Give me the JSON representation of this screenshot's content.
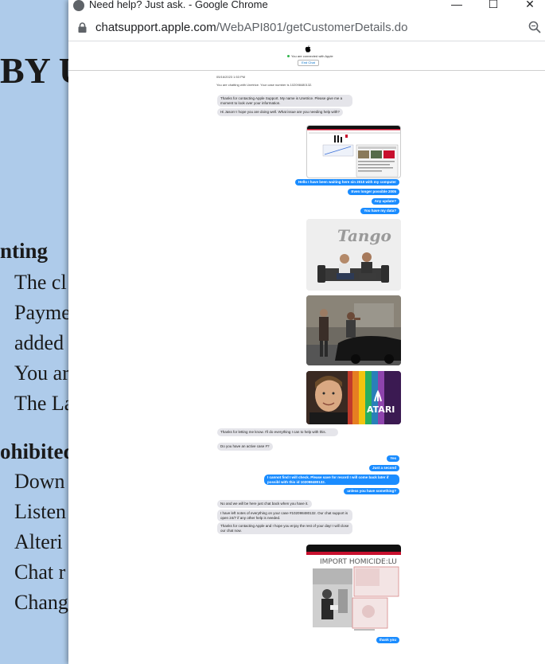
{
  "background_doc": {
    "heading_fragment": "BY U",
    "section1": "nting",
    "section1_items": [
      "The cl",
      "Payme",
      "added",
      "You ar",
      "The La"
    ],
    "section2": "ohibited",
    "section2_items": [
      "Down",
      "Listen",
      "Alteri",
      "Chat r",
      "Chang"
    ]
  },
  "window": {
    "title": "Need help? Just ask. - Google Chrome",
    "minimize_glyph": "—",
    "maximize_glyph": "☐",
    "close_glyph": "✕",
    "url_domain": "chatsupport.apple.com",
    "url_path": "/WebAPI801/getCustomerDetails.do"
  },
  "chat_header": {
    "connected_text": "You are connected with Apple",
    "end_chat_label": "End Chat"
  },
  "chat": {
    "timestamp": "05/16/2023 1:53 PM",
    "case_notice": "You are chatting with Unetrice. Your case number is 102098480132.",
    "agent_greeting": "Thanks for contacting Apple Support. My name is Unetrice. Please give me a moment to look over your information.",
    "agent_q1": "Hi Jason! I hope you are doing well. What issue are you needing help with?",
    "user_m1": "Hello I have been waiting here sin 2010 with my computer",
    "user_m2": "Even longer possible 2005",
    "user_m3": "Any update?",
    "user_m4": "You have my data?",
    "tango_text": "Tango",
    "atari_text": "ATARI",
    "agent_a1": "Thanks for letting me know. I'll do everything I can to help with this.",
    "agent_a2": "Do you have an active case #?",
    "user_m5": "Yes",
    "user_m6": "Just a second",
    "user_m7": "I cannot find I will check. Please save for record I will come back later if possibl with this id 102098480132.",
    "user_m8": "unless you have something?",
    "agent_b1": "No and we will be here just chat back when you have it.",
    "agent_b2": "I have left notes of everything on your case #102098480132. Our chat support is open 24/7 if any other help is needed.",
    "agent_b3": "Thanks for contacting Apple and I hope you enjoy the rest of your day! I will close our chat now.",
    "homicide_text": "IMPORT HOMICIDE:LU",
    "user_m9": "thank you"
  },
  "colors": {
    "user_bubble": "#1a8cff",
    "agent_bubble": "#e5e5ea",
    "background_doc": "#aecbea"
  }
}
